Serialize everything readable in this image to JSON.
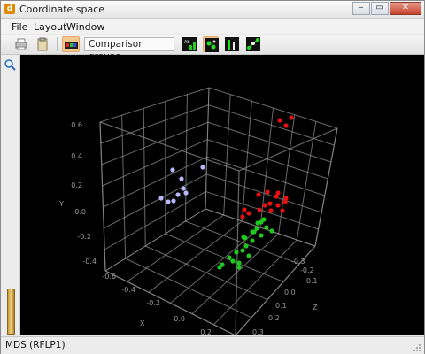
{
  "window": {
    "title": "Coordinate space",
    "app_icon": "app-icon"
  },
  "menu": {
    "items": [
      "File",
      "Layout",
      "Window"
    ]
  },
  "toolbar": {
    "group_label": "Comparison groups",
    "icons": [
      "print-icon",
      "clipboard-icon",
      "color-palette-icon",
      "chart-labels-icon",
      "scatter-icon",
      "axis-icon",
      "network-icon"
    ]
  },
  "sidebar": {
    "zoom_icon": "zoom-icon"
  },
  "status": {
    "text": "MDS (RFLP1)"
  },
  "colors": {
    "red": "#e81010",
    "green": "#1fc81f",
    "lavender": "#b8b8f8",
    "grid": "#8c8c8c"
  },
  "axes": {
    "y_label": "Y",
    "x_label": "X",
    "z_label": "Z",
    "y_ticks": [
      "0.6",
      "0.4",
      "0.2",
      "-0.0",
      "-0.2",
      "-0.4"
    ],
    "x_ticks": [
      "-0.6",
      "-0.4",
      "-0.2",
      "-0.0",
      "0.2"
    ],
    "z_ticks": [
      "-0.3",
      "-0.2",
      "-0.1",
      "0.0",
      "0.1",
      "0.2",
      "0.3"
    ]
  },
  "chart_data": {
    "type": "scatter",
    "series": [
      {
        "color": "#e81010",
        "count": 18
      },
      {
        "color": "#1fc81f",
        "count": 22
      },
      {
        "color": "#b8b8f8",
        "count": 9
      }
    ]
  }
}
